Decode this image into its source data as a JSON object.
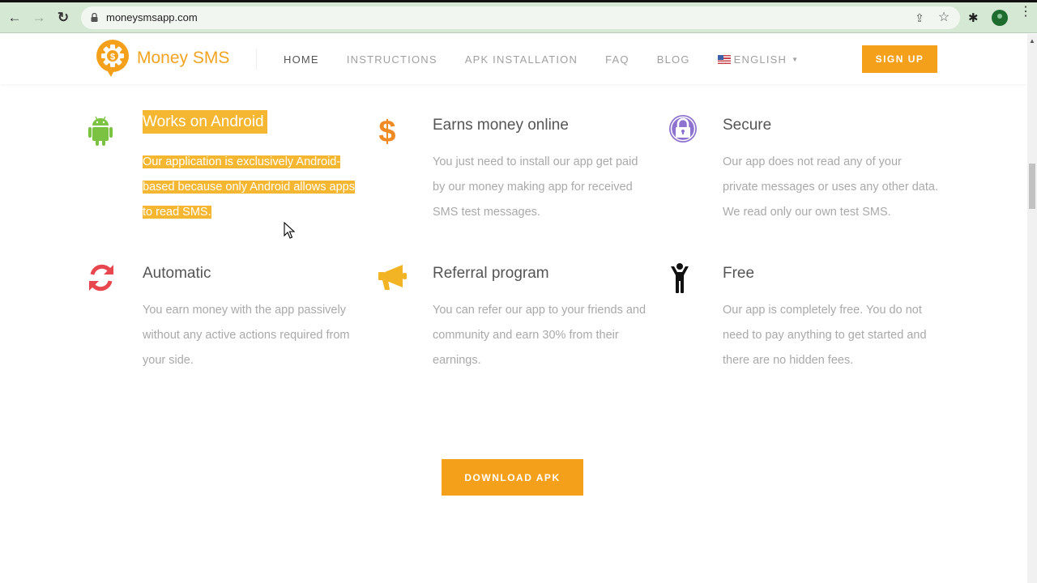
{
  "browser": {
    "url": "moneysmsapp.com",
    "back_icon": "←",
    "forward_icon": "→",
    "reload_icon": "↻",
    "share_icon": "⇪",
    "bookmark_icon": "☆",
    "extensions_icon": "✱",
    "menu_icon": "⋮"
  },
  "header": {
    "brand": "Money SMS",
    "nav": [
      {
        "label": "HOME",
        "active": true
      },
      {
        "label": "INSTRUCTIONS",
        "active": false
      },
      {
        "label": "APK INSTALLATION",
        "active": false
      },
      {
        "label": "FAQ",
        "active": false
      },
      {
        "label": "BLOG",
        "active": false
      }
    ],
    "language": "ENGLISH",
    "signup_label": "SIGN UP"
  },
  "features": [
    {
      "icon": "android-icon",
      "title": "Works on Android",
      "lines": [
        "Our application is exclusively Android-",
        "based because only Android allows apps",
        "to read SMS."
      ],
      "selected": true
    },
    {
      "icon": "dollar-icon",
      "title": "Earns money online",
      "lines": [
        "You just need to install our app get paid",
        "by our money making app for received",
        "SMS test messages."
      ],
      "selected": false
    },
    {
      "icon": "lock-icon",
      "title": "Secure",
      "lines": [
        "Our app does not read any of your",
        "private messages or uses any other data.",
        "We read only our own test SMS."
      ],
      "selected": false
    },
    {
      "icon": "refresh-icon",
      "title": "Automatic",
      "lines": [
        "You earn money with the app passively",
        "without any active actions required from",
        "your side."
      ],
      "selected": false
    },
    {
      "icon": "megaphone-icon",
      "title": "Referral program",
      "lines": [
        "You can refer our app to your friends and",
        "community and earn 30% from their",
        "earnings."
      ],
      "selected": false
    },
    {
      "icon": "child-icon",
      "title": "Free",
      "lines": [
        "Our app is completely free. You do not",
        "need to pay anything to get started and",
        "there are no hidden fees."
      ],
      "selected": false
    }
  ],
  "download_label": "DOWNLOAD APK",
  "colors": {
    "brand_orange": "#f5a01a",
    "highlight": "#f5b731",
    "android_green": "#7cc242",
    "dollar_orange": "#f08a24",
    "lock_purple": "#8e72cf",
    "refresh_red": "#e8474f",
    "megaphone_yellow": "#f2b324",
    "child_black": "#111111"
  }
}
